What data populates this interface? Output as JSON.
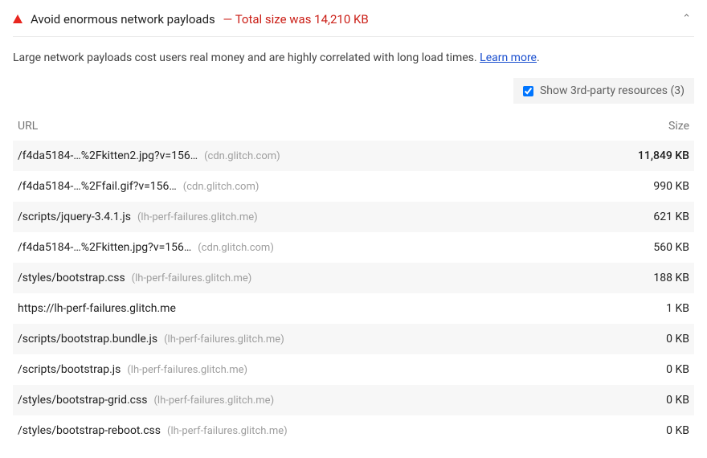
{
  "audit": {
    "title": "Avoid enormous network payloads",
    "metric_prefix": "—",
    "metric_text": "Total size was 14,210 KB",
    "description": "Large network payloads cost users real money and are highly correlated with long load times.",
    "learn_more_label": "Learn more",
    "chevron_glyph": "⌃"
  },
  "third_party": {
    "label": "Show 3rd-party resources (3)",
    "checked": true
  },
  "columns": {
    "url": "URL",
    "size": "Size"
  },
  "rows": [
    {
      "path": "/f4da5184-…%2Fkitten2.jpg?v=156…",
      "host": "(cdn.glitch.com)",
      "size": "11,849 KB"
    },
    {
      "path": "/f4da5184-…%2Ffail.gif?v=156…",
      "host": "(cdn.glitch.com)",
      "size": "990 KB"
    },
    {
      "path": "/scripts/jquery-3.4.1.js",
      "host": "(lh-perf-failures.glitch.me)",
      "size": "621 KB"
    },
    {
      "path": "/f4da5184-…%2Fkitten.jpg?v=156…",
      "host": "(cdn.glitch.com)",
      "size": "560 KB"
    },
    {
      "path": "/styles/bootstrap.css",
      "host": "(lh-perf-failures.glitch.me)",
      "size": "188 KB"
    },
    {
      "path": "https://lh-perf-failures.glitch.me",
      "host": "",
      "size": "1 KB"
    },
    {
      "path": "/scripts/bootstrap.bundle.js",
      "host": "(lh-perf-failures.glitch.me)",
      "size": "0 KB"
    },
    {
      "path": "/scripts/bootstrap.js",
      "host": "(lh-perf-failures.glitch.me)",
      "size": "0 KB"
    },
    {
      "path": "/styles/bootstrap-grid.css",
      "host": "(lh-perf-failures.glitch.me)",
      "size": "0 KB"
    },
    {
      "path": "/styles/bootstrap-reboot.css",
      "host": "(lh-perf-failures.glitch.me)",
      "size": "0 KB"
    }
  ]
}
